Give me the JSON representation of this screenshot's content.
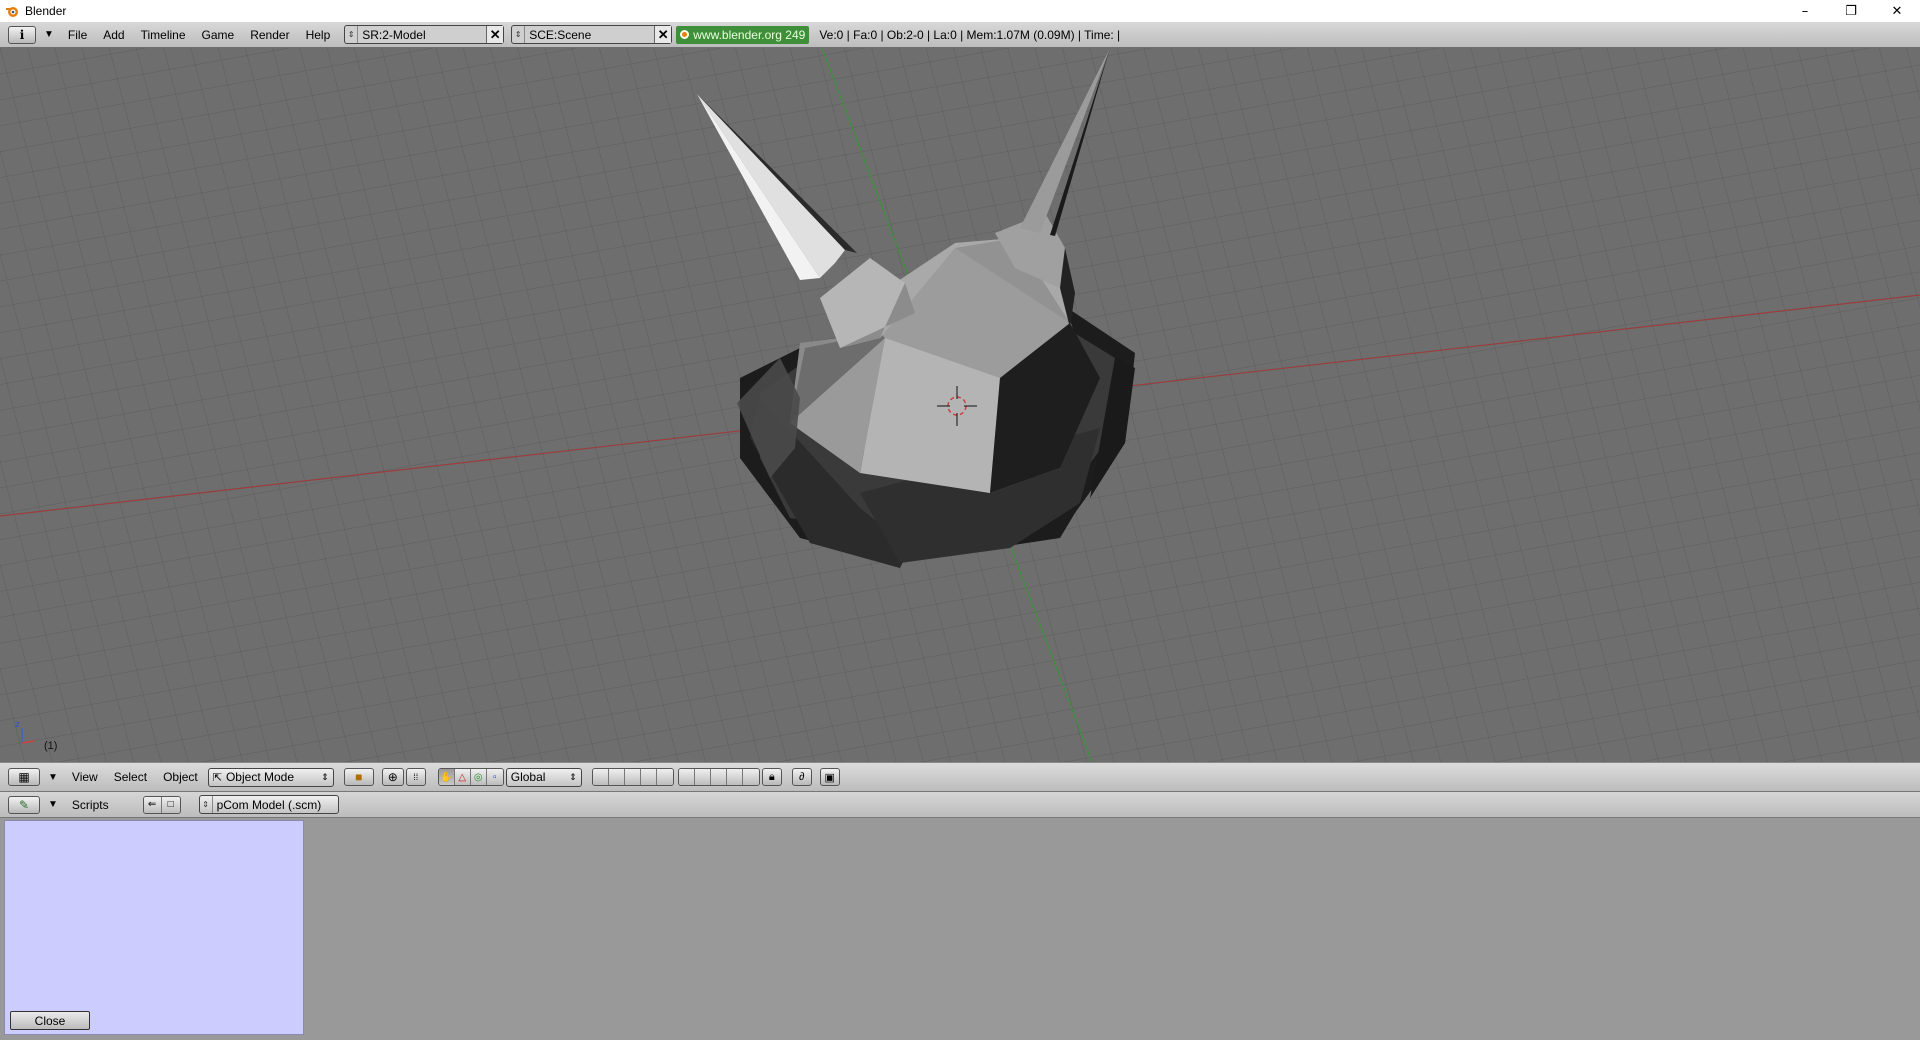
{
  "window": {
    "title": "Blender",
    "controls": {
      "minimize": "–",
      "maximize": "❐",
      "close": "✕"
    }
  },
  "info_header": {
    "menus": [
      "File",
      "Add",
      "Timeline",
      "Game",
      "Render",
      "Help"
    ],
    "screen_field": "SR:2-Model",
    "scene_field": "SCE:Scene",
    "link": "www.blender.org 249",
    "stats": "Ve:0 | Fa:0 | Ob:2-0 | La:0  | Mem:1.07M (0.09M)  | Time: |"
  },
  "viewport": {
    "frame_label": "(1)",
    "axis_z": "z",
    "axis_x": "x"
  },
  "view3d_header": {
    "menus": [
      "View",
      "Select",
      "Object"
    ],
    "mode": "Object Mode",
    "orientation": "Global"
  },
  "scripts_header": {
    "window_type_label": "Scripts",
    "script_name": "pCom Model (.scm)"
  },
  "scripts_panel": {
    "close_label": "Close"
  },
  "colors": {
    "viewport_bg": "#6e6e6e",
    "grid_line": "#5f5f5f",
    "x_axis": "#9a3d3d",
    "y_axis": "#3e8f3e",
    "script_panel_bg": "#ccccff",
    "link_bg": "#3f8f3a"
  }
}
